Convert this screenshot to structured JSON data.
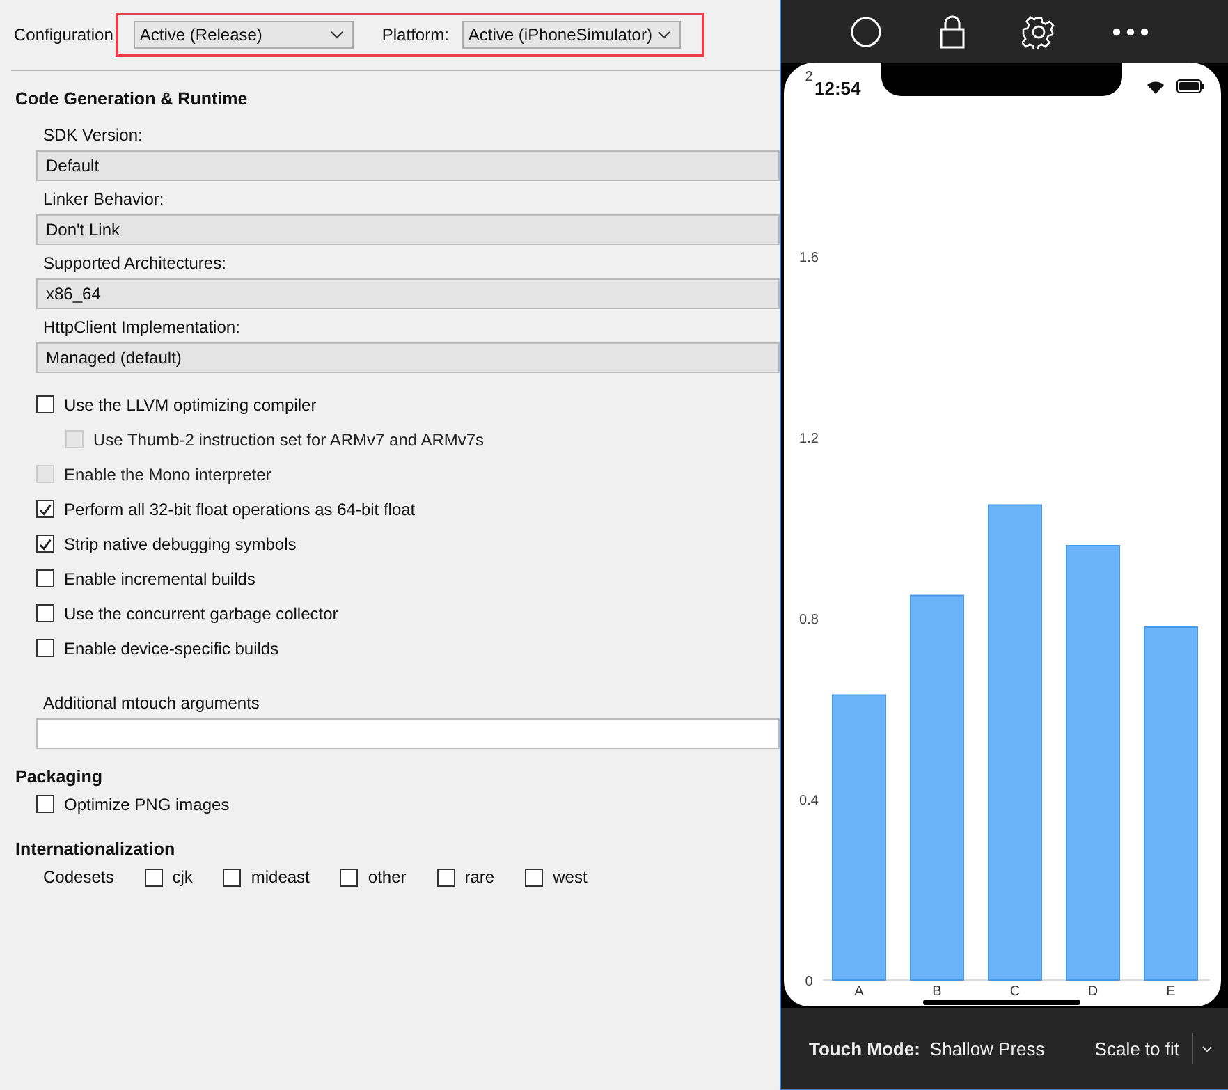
{
  "toolbar": {
    "configuration": {
      "label": "Configuration",
      "value": "Active (Release)"
    },
    "platform": {
      "label": "Platform:",
      "value": "Active (iPhoneSimulator)"
    }
  },
  "sections": [
    {
      "title": "Code Generation & Runtime",
      "items": [
        {
          "kind": "select",
          "label": "SDK Version:",
          "value": "Default"
        },
        {
          "kind": "select",
          "label": "Linker Behavior:",
          "value": "Don't Link"
        },
        {
          "kind": "select",
          "label": "Supported Architectures:",
          "value": "x86_64"
        },
        {
          "kind": "select",
          "label": "HttpClient Implementation:",
          "value": "Managed (default)"
        },
        {
          "kind": "checkbox",
          "label": "Use the LLVM optimizing compiler",
          "checked": false,
          "disabled": false,
          "children": [
            {
              "kind": "checkbox",
              "label": "Use Thumb-2 instruction set for ARMv7 and ARMv7s",
              "checked": false,
              "disabled": true
            }
          ]
        },
        {
          "kind": "checkbox",
          "label": "Enable the Mono interpreter",
          "checked": false,
          "disabled": true
        },
        {
          "kind": "checkbox",
          "label": "Perform all 32-bit float operations as 64-bit float",
          "checked": true,
          "disabled": false
        },
        {
          "kind": "checkbox",
          "label": "Strip native debugging symbols",
          "checked": true,
          "disabled": false
        },
        {
          "kind": "checkbox",
          "label": "Enable incremental builds",
          "checked": false,
          "disabled": false
        },
        {
          "kind": "checkbox",
          "label": "Use the concurrent garbage collector",
          "checked": false,
          "disabled": false
        },
        {
          "kind": "checkbox",
          "label": "Enable device-specific builds",
          "checked": false,
          "disabled": false
        },
        {
          "kind": "textfield",
          "label": "Additional mtouch arguments"
        }
      ]
    },
    {
      "title": "Packaging",
      "items": [
        {
          "kind": "checkbox",
          "label": "Optimize PNG images",
          "checked": false,
          "disabled": false
        }
      ]
    },
    {
      "title": "Internationalization",
      "items": [
        {
          "kind": "checkgroup",
          "label": "Codesets",
          "options": [
            {
              "label": "cjk",
              "checked": false
            },
            {
              "label": "mideast",
              "checked": false
            },
            {
              "label": "other",
              "checked": false
            },
            {
              "label": "rare",
              "checked": false
            },
            {
              "label": "west",
              "checked": false
            }
          ]
        }
      ]
    }
  ],
  "simulator": {
    "time": "12:54",
    "chart_data": {
      "type": "bar",
      "categories": [
        "A",
        "B",
        "C",
        "D",
        "E"
      ],
      "values": [
        0.63,
        0.85,
        1.05,
        0.96,
        0.78
      ],
      "ylim": [
        0,
        2
      ],
      "yticks": [
        0,
        0.4,
        0.8,
        1.2,
        1.6,
        2
      ]
    },
    "bottom_bar": {
      "touch_mode_label": "Touch Mode:",
      "touch_mode": "Shallow Press",
      "scale": "Scale to fit"
    }
  }
}
